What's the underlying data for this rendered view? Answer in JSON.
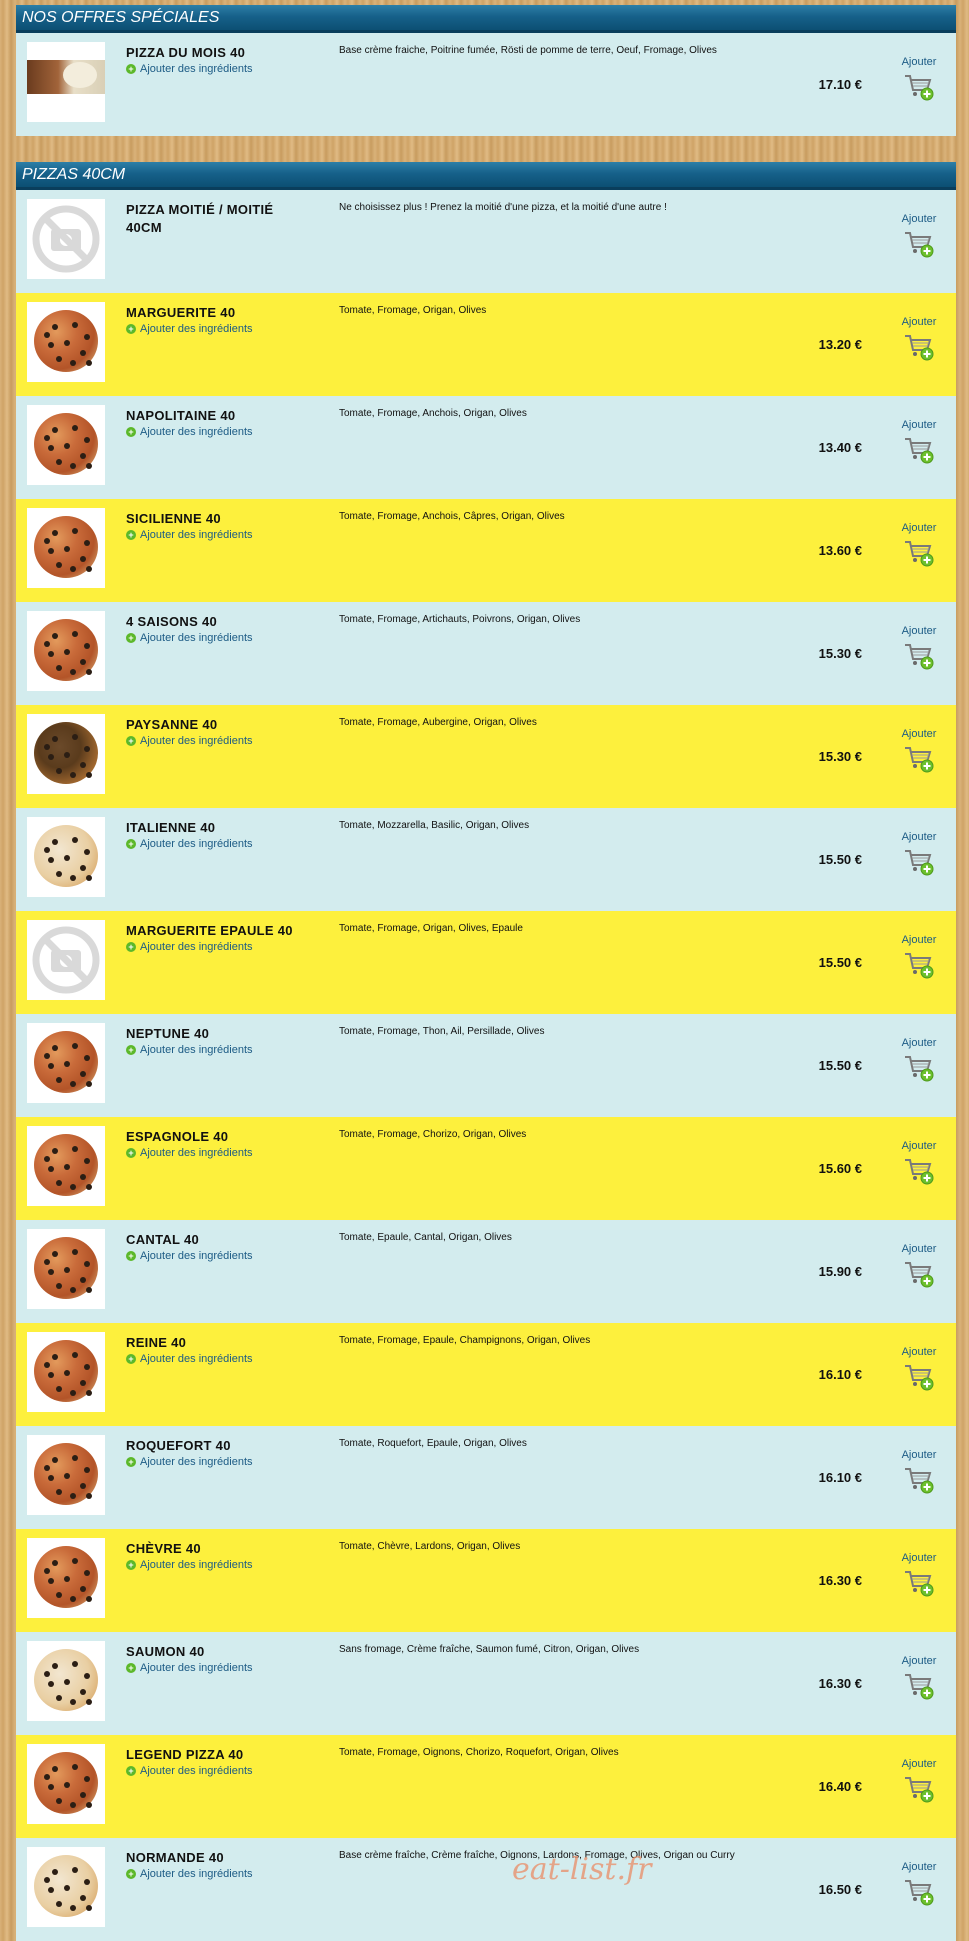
{
  "sections": [
    {
      "title": "NOS OFFRES SPÉCIALES",
      "items": [
        {
          "name": "PIZZA DU MOIS 40",
          "ingredients_link": "Ajouter des ingrédients",
          "description": "Base crème fraiche, Poitrine fumée, Rösti de pomme de terre, Oeuf, Fromage, Olives",
          "price": "17.10 €",
          "add_label": "Ajouter",
          "image": "pizza-photo",
          "bg": "blue"
        }
      ]
    },
    {
      "title": "PIZZAS 40CM",
      "items": [
        {
          "name": "PIZZA MOITIÉ / MOITIÉ 40CM",
          "ingredients_link": "",
          "description": "Ne choisissez plus ! Prenez la moitié d'une pizza, et la moitié d'une autre !",
          "price": "",
          "add_label": "Ajouter",
          "image": "no-image",
          "bg": "blue"
        },
        {
          "name": "MARGUERITE 40",
          "ingredients_link": "Ajouter des ingrédients",
          "description": "Tomate, Fromage, Origan, Olives",
          "price": "13.20 €",
          "add_label": "Ajouter",
          "image": "pizza",
          "bg": "yellow"
        },
        {
          "name": "NAPOLITAINE 40",
          "ingredients_link": "Ajouter des ingrédients",
          "description": "Tomate, Fromage, Anchois, Origan, Olives",
          "price": "13.40 €",
          "add_label": "Ajouter",
          "image": "pizza",
          "bg": "blue"
        },
        {
          "name": "SICILIENNE 40",
          "ingredients_link": "Ajouter des ingrédients",
          "description": "Tomate, Fromage, Anchois, Câpres, Origan, Olives",
          "price": "13.60 €",
          "add_label": "Ajouter",
          "image": "pizza",
          "bg": "yellow"
        },
        {
          "name": "4 SAISONS 40",
          "ingredients_link": "Ajouter des ingrédients",
          "description": "Tomate, Fromage, Artichauts, Poivrons, Origan, Olives",
          "price": "15.30 €",
          "add_label": "Ajouter",
          "image": "pizza",
          "bg": "blue"
        },
        {
          "name": "PAYSANNE 40",
          "ingredients_link": "Ajouter des ingrédients",
          "description": "Tomate, Fromage, Aubergine, Origan, Olives",
          "price": "15.30 €",
          "add_label": "Ajouter",
          "image": "pizza-dark",
          "bg": "yellow"
        },
        {
          "name": "ITALIENNE 40",
          "ingredients_link": "Ajouter des ingrédients",
          "description": "Tomate, Mozzarella, Basilic, Origan, Olives",
          "price": "15.50 €",
          "add_label": "Ajouter",
          "image": "pizza-light",
          "bg": "blue"
        },
        {
          "name": "MARGUERITE EPAULE 40",
          "ingredients_link": "Ajouter des ingrédients",
          "description": "Tomate, Fromage, Origan, Olives, Epaule",
          "price": "15.50 €",
          "add_label": "Ajouter",
          "image": "no-image",
          "bg": "yellow"
        },
        {
          "name": "NEPTUNE 40",
          "ingredients_link": "Ajouter des ingrédients",
          "description": "Tomate, Fromage, Thon, Ail, Persillade, Olives",
          "price": "15.50 €",
          "add_label": "Ajouter",
          "image": "pizza",
          "bg": "blue"
        },
        {
          "name": "ESPAGNOLE 40",
          "ingredients_link": "Ajouter des ingrédients",
          "description": "Tomate, Fromage, Chorizo, Origan, Olives",
          "price": "15.60 €",
          "add_label": "Ajouter",
          "image": "pizza",
          "bg": "yellow"
        },
        {
          "name": "CANTAL 40",
          "ingredients_link": "Ajouter des ingrédients",
          "description": "Tomate, Epaule, Cantal, Origan, Olives",
          "price": "15.90 €",
          "add_label": "Ajouter",
          "image": "pizza",
          "bg": "blue"
        },
        {
          "name": "REINE 40",
          "ingredients_link": "Ajouter des ingrédients",
          "description": "Tomate, Fromage, Epaule, Champignons, Origan, Olives",
          "price": "16.10 €",
          "add_label": "Ajouter",
          "image": "pizza",
          "bg": "yellow"
        },
        {
          "name": "ROQUEFORT 40",
          "ingredients_link": "Ajouter des ingrédients",
          "description": "Tomate, Roquefort, Epaule, Origan, Olives",
          "price": "16.10 €",
          "add_label": "Ajouter",
          "image": "pizza",
          "bg": "blue"
        },
        {
          "name": "CHÈVRE 40",
          "ingredients_link": "Ajouter des ingrédients",
          "description": "Tomate, Chèvre, Lardons, Origan, Olives",
          "price": "16.30 €",
          "add_label": "Ajouter",
          "image": "pizza",
          "bg": "yellow"
        },
        {
          "name": "SAUMON 40",
          "ingredients_link": "Ajouter des ingrédients",
          "description": "Sans fromage, Crème fraîche, Saumon fumé, Citron, Origan, Olives",
          "price": "16.30 €",
          "add_label": "Ajouter",
          "image": "pizza-light",
          "bg": "blue"
        },
        {
          "name": "LEGEND PIZZA 40",
          "ingredients_link": "Ajouter des ingrédients",
          "description": "Tomate, Fromage, Oignons, Chorizo, Roquefort, Origan, Olives",
          "price": "16.40 €",
          "add_label": "Ajouter",
          "image": "pizza",
          "bg": "yellow"
        },
        {
          "name": "NORMANDE 40",
          "ingredients_link": "Ajouter des ingrédients",
          "description": "Base crème fraîche, Crème fraîche, Oignons, Lardons, Fromage, Olives, Origan ou Curry",
          "price": "16.50 €",
          "add_label": "Ajouter",
          "image": "pizza-light",
          "bg": "blue"
        }
      ]
    }
  ],
  "watermark": "eat-list.fr",
  "colors": {
    "blue_row": "#d3ecee",
    "yellow_row": "#fdf03d",
    "header": "#16618a",
    "link": "#1c5b85",
    "plus": "#5cb82a"
  }
}
